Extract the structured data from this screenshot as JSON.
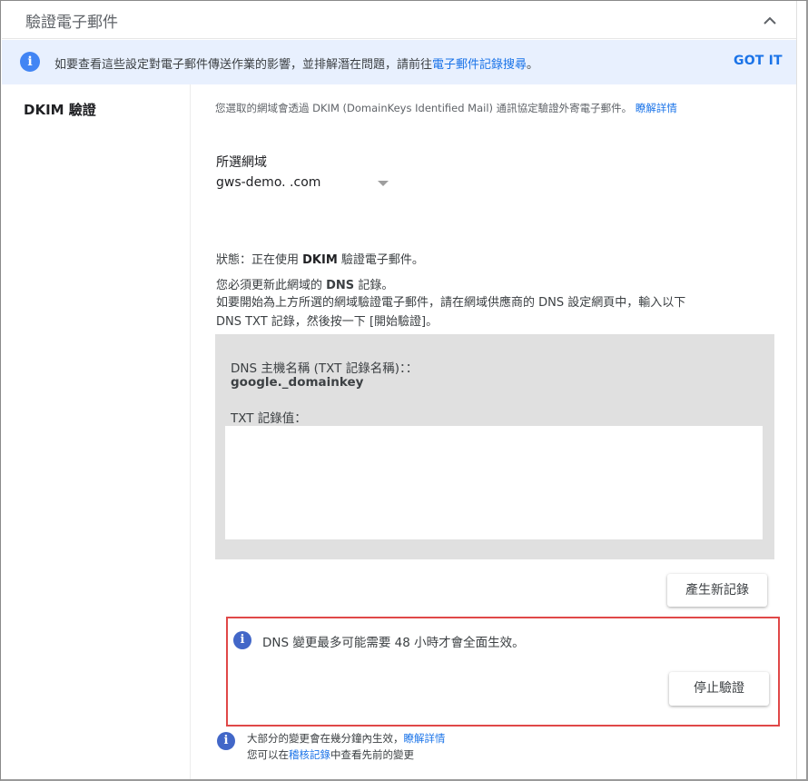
{
  "header": {
    "title": "驗證電子郵件"
  },
  "banner": {
    "text": "如要查看這些設定對電子郵件傳送作業的影響，並排解潛在問題，請前往",
    "link": "電子郵件記錄搜尋",
    "suffix": "。",
    "got_it": "GOT IT",
    "icon": "info-icon"
  },
  "section": {
    "label": "DKIM 驗證",
    "description": "您選取的網域會透過 DKIM (DomainKeys Identified Mail) 通訊協定驗證外寄電子郵件。",
    "learn_more": "瞭解詳情"
  },
  "domain": {
    "label": "所選網域",
    "value": "gws-demo.          .com"
  },
  "status": {
    "prefix": "狀態：正在使用 ",
    "bold": "DKIM",
    "suffix": " 驗證電子郵件。"
  },
  "instructions": {
    "must_prefix": "您必須更新此網域的 ",
    "must_bold": "DNS",
    "must_suffix": " 記錄。",
    "line1": "如要開始為上方所選的網域驗證電子郵件，請在網域供應商的 DNS 設定網頁中，輸入以下",
    "line2": "DNS TXT 記錄，然後按一下 [開始驗證]。"
  },
  "dns": {
    "host_label": "DNS 主機名稱 (TXT 記錄名稱)：：",
    "host_value": "google._domainkey",
    "txt_label": "TXT 記錄值：",
    "txt_value": ""
  },
  "buttons": {
    "generate": "產生新記錄",
    "stop": "停止驗證"
  },
  "notice": {
    "text": "DNS 變更最多可能需要 48 小時才會全面生效。"
  },
  "footer": {
    "line1": "大部分的變更會在幾分鐘內生效，",
    "line1_link": "瞭解詳情",
    "line2_prefix": "您可以在",
    "line2_link": "稽核記錄",
    "line2_suffix": "中查看先前的變更"
  },
  "colors": {
    "accent": "#1a73e8",
    "banner_bg": "#e8f0fe",
    "dns_box_bg": "#e0e0e0",
    "highlight_border": "#e04848"
  }
}
